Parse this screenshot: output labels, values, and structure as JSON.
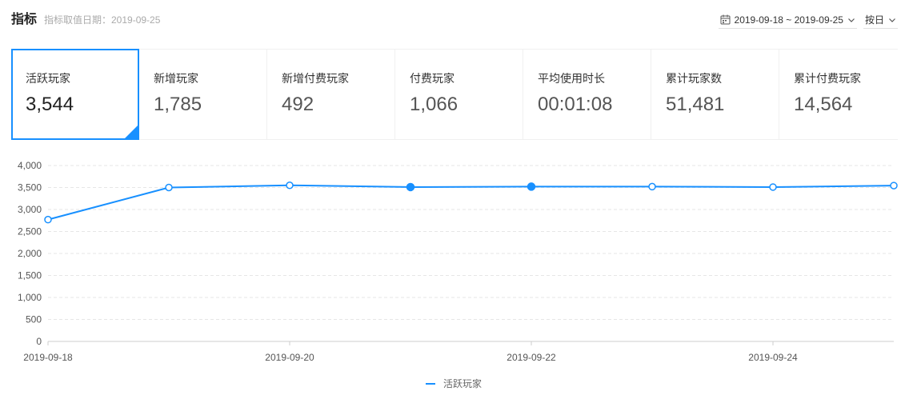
{
  "header": {
    "title": "指标",
    "subtitle": "指标取值日期：2019-09-25",
    "date_range": "2019-09-18 ~ 2019-09-25",
    "granularity": "按日",
    "icons": {
      "date_picker": "calendar-icon",
      "dropdown": "chevron-down-icon"
    }
  },
  "metrics": [
    {
      "label": "活跃玩家",
      "value": "3,544",
      "selected": true
    },
    {
      "label": "新增玩家",
      "value": "1,785",
      "selected": false
    },
    {
      "label": "新增付费玩家",
      "value": "492",
      "selected": false
    },
    {
      "label": "付费玩家",
      "value": "1,066",
      "selected": false
    },
    {
      "label": "平均使用时长",
      "value": "00:01:08",
      "selected": false
    },
    {
      "label": "累计玩家数",
      "value": "51,481",
      "selected": false
    },
    {
      "label": "累计付费玩家",
      "value": "14,564",
      "selected": false
    }
  ],
  "colors": {
    "accent": "#1890ff",
    "text": "#333333",
    "muted": "#aaaaaa",
    "grid": "#e6e6e6",
    "axis": "#cccccc"
  },
  "chart_data": {
    "type": "line",
    "x": [
      "2019-09-18",
      "2019-09-19",
      "2019-09-20",
      "2019-09-21",
      "2019-09-22",
      "2019-09-23",
      "2019-09-24",
      "2019-09-25"
    ],
    "xticks": [
      "2019-09-18",
      "2019-09-20",
      "2019-09-22",
      "2019-09-24"
    ],
    "yticks": [
      0,
      500,
      1000,
      1500,
      2000,
      2500,
      3000,
      3500,
      4000
    ],
    "ylim": [
      0,
      4000
    ],
    "grid": true,
    "legend": "bottom-center",
    "series": [
      {
        "name": "活跃玩家",
        "values": [
          2770,
          3500,
          3550,
          3510,
          3520,
          3520,
          3510,
          3544
        ],
        "marker_filled": [
          false,
          false,
          false,
          true,
          true,
          false,
          false,
          false
        ]
      }
    ]
  }
}
